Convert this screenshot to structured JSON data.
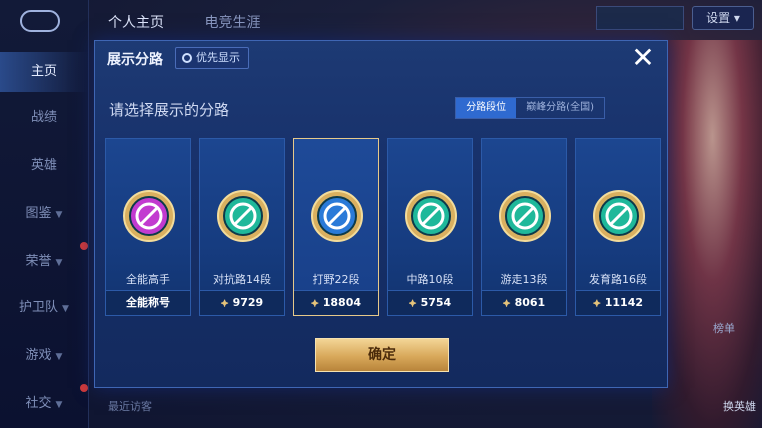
{
  "sidebar": {
    "items": [
      {
        "label": "主页"
      },
      {
        "label": "战绩"
      },
      {
        "label": "英雄"
      },
      {
        "label": "图鉴"
      },
      {
        "label": "荣誉"
      },
      {
        "label": "护卫队"
      },
      {
        "label": "游戏"
      },
      {
        "label": "社交"
      }
    ]
  },
  "header": {
    "tabs": [
      "个人主页",
      "电竞生涯"
    ],
    "settings_label": "设置"
  },
  "background": {
    "rank_label": "榜单",
    "switch_hero_label": "换英雄",
    "recent_label": "最近访客"
  },
  "modal": {
    "title": "展示分路",
    "priority_label": "优先显示",
    "close_label": "✕",
    "subtitle": "请选择展示的分路",
    "segments": [
      "分路段位",
      "巅峰分路(全国)"
    ],
    "cards": [
      {
        "label": "全能高手",
        "value": "全能称号",
        "show_icon": false,
        "badge_color": "#c23ad0",
        "badge_icon": "dual-square-icon"
      },
      {
        "label": "对抗路14段",
        "value": "9729",
        "show_icon": true,
        "badge_color": "#1fb89a",
        "badge_icon": "sword-icon"
      },
      {
        "label": "打野22段",
        "value": "18804",
        "show_icon": true,
        "badge_color": "#2a7ad8",
        "badge_icon": "swirl-icon"
      },
      {
        "label": "中路10段",
        "value": "5754",
        "show_icon": true,
        "badge_color": "#1fb89a",
        "badge_icon": "wand-icon"
      },
      {
        "label": "游走13段",
        "value": "8061",
        "show_icon": true,
        "badge_color": "#1fb89a",
        "badge_icon": "shield-icon"
      },
      {
        "label": "发育路16段",
        "value": "11142",
        "show_icon": true,
        "badge_color": "#1fb89a",
        "badge_icon": "circle-slash-icon"
      }
    ],
    "selected_index": 2,
    "confirm_label": "确定"
  }
}
